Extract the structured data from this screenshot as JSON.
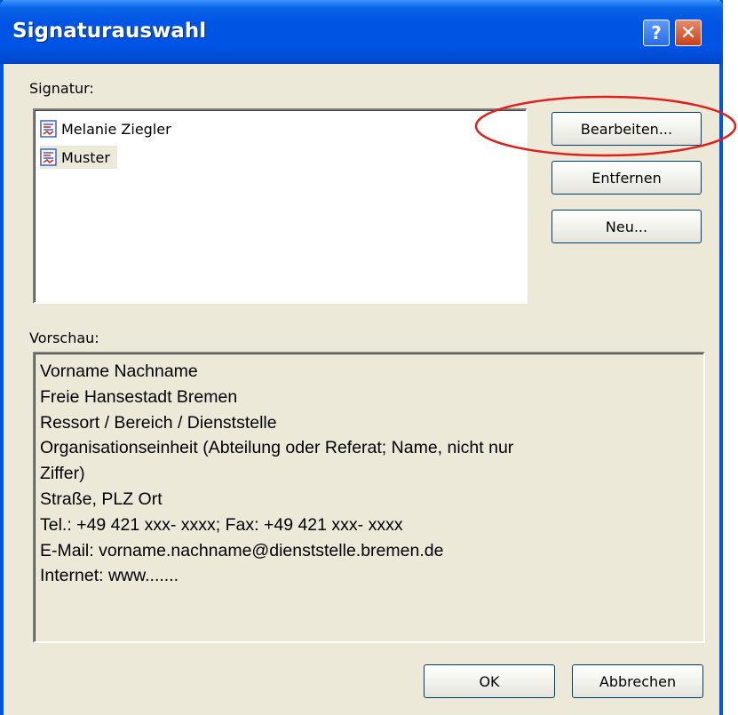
{
  "window": {
    "title": "Signaturauswahl",
    "help_label": "?",
    "close_label": "✕"
  },
  "signature_section": {
    "label": "Signatur:",
    "items": [
      {
        "name": "Melanie Ziegler",
        "icon": "signature-doc-icon",
        "selected": false
      },
      {
        "name": "Muster",
        "icon": "signature-doc-icon",
        "selected": true
      }
    ]
  },
  "buttons": {
    "edit": "Bearbeiten...",
    "remove": "Entfernen",
    "new": "Neu...",
    "ok": "OK",
    "cancel": "Abbrechen"
  },
  "preview": {
    "label": "Vorschau:",
    "lines": [
      "Vorname Nachname",
      "Freie Hansestadt Bremen",
      "Ressort / Bereich / Dienststelle",
      "Organisationseinheit (Abteilung oder Referat; Name, nicht nur",
      "Ziffer)",
      "Straße, PLZ Ort",
      "Tel.: +49 421 xxx- xxxx; Fax: +49 421 xxx- xxxx",
      "E-Mail: vorname.nachname@dienststelle.bremen.de",
      "Internet: www......."
    ]
  },
  "colors": {
    "titlebar": "#0054E3",
    "dialog_bg": "#ECE9D8",
    "annotation": "#E0201C"
  }
}
